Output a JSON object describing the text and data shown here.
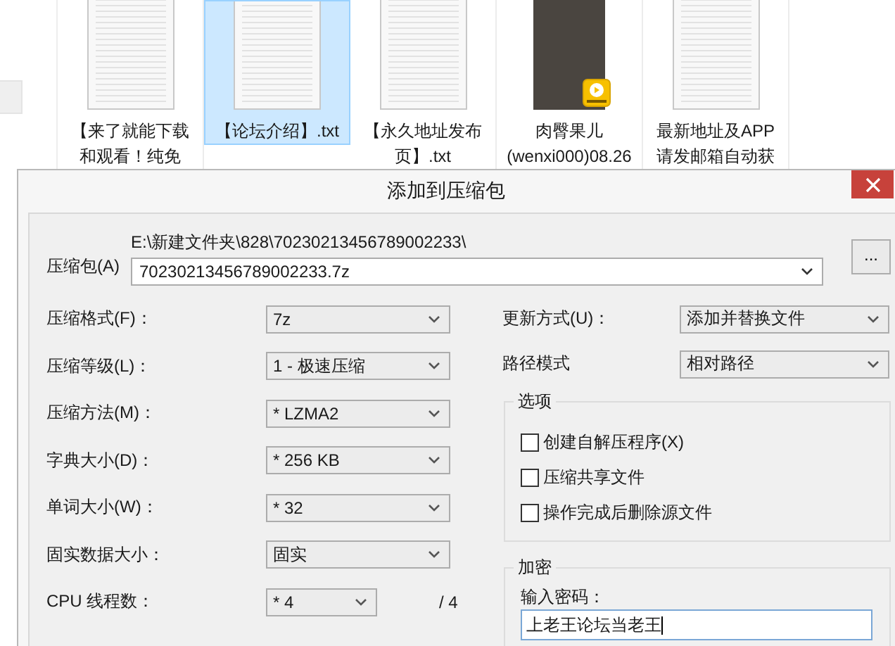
{
  "explorer": {
    "files": [
      {
        "kind": "document",
        "selected": false,
        "label_lines": [
          "【来了就能下载",
          "和观看！纯免"
        ]
      },
      {
        "kind": "document",
        "selected": true,
        "label_lines": [
          "【论坛介绍】.txt"
        ]
      },
      {
        "kind": "document",
        "selected": false,
        "label_lines": [
          "【永久地址发布",
          "页】.txt"
        ]
      },
      {
        "kind": "video",
        "selected": false,
        "label_lines": [
          "肉臀果儿",
          "(wenxi000)08.26"
        ]
      },
      {
        "kind": "document",
        "selected": false,
        "label_lines": [
          "最新地址及APP",
          "请发邮箱自动获"
        ]
      }
    ]
  },
  "dialog": {
    "title": "添加到压缩包",
    "archive": {
      "label": "压缩包(A)",
      "path": "E:\\新建文件夹\\828\\70230213456789002233\\",
      "filename": "70230213456789002233.7z",
      "browse_button": "..."
    },
    "left_settings": [
      {
        "label": "压缩格式(F)：",
        "value": "7z",
        "kind": "wide"
      },
      {
        "label": "压缩等级(L)：",
        "value": "1 - 极速压缩",
        "kind": "wide"
      },
      {
        "label": "压缩方法(M)：",
        "value": "* LZMA2",
        "kind": "wide"
      },
      {
        "label": "字典大小(D)：",
        "value": "* 256 KB",
        "kind": "wide"
      },
      {
        "label": "单词大小(W)：",
        "value": "* 32",
        "kind": "wide"
      },
      {
        "label": "固实数据大小：",
        "value": "固实",
        "kind": "wide"
      },
      {
        "label": "CPU 线程数：",
        "value": "* 4",
        "kind": "narrow",
        "suffix": "/ 4"
      }
    ],
    "right_settings": [
      {
        "label": "更新方式(U)：",
        "value": "添加并替换文件"
      },
      {
        "label": "路径模式",
        "value": "相对路径"
      }
    ],
    "options": {
      "title": "选项",
      "checkboxes": [
        {
          "label": "创建自解压程序(X)",
          "checked": false
        },
        {
          "label": "压缩共享文件",
          "checked": false
        },
        {
          "label": "操作完成后删除源文件",
          "checked": false
        }
      ]
    },
    "encryption": {
      "title": "加密",
      "password_label": "输入密码：",
      "password": "上老王论坛当老王"
    }
  }
}
